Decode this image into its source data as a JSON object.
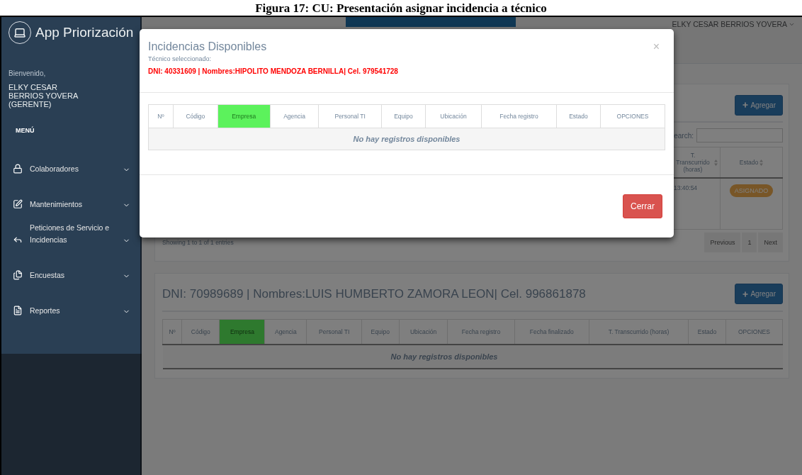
{
  "caption": "Figura 17: CU: Presentación asignar incidencia a técnico",
  "sidebar": {
    "title": "App Priorización",
    "welcome": "Bienvenido,",
    "user": "ELKY CESAR BERRIOS YOVERA (GERENTE)",
    "menu_label": "MENÚ",
    "items": [
      {
        "kind": "lock",
        "label": "Colaboradores"
      },
      {
        "kind": "edit",
        "label": "Mantenimientos"
      },
      {
        "kind": "reply",
        "label": "Peticiones de Servicio e Incidencias"
      },
      {
        "kind": "files",
        "label": "Encuestas"
      },
      {
        "kind": "report",
        "label": "Reportes"
      }
    ]
  },
  "topbar": {
    "user": "ELKY CESAR BERRIOS YOVERA"
  },
  "panel1": {
    "add_button": "Agregar",
    "search_label": "earch:",
    "columns": [
      {
        "label": "T. Transcurrido (horas)",
        "sortable": true
      },
      {
        "label": "Estado",
        "sortable": true
      }
    ],
    "rows": [
      {
        "time": "13:40:54",
        "status": "ASIGNADO"
      }
    ],
    "info": "Showing 1 to 1 of 1 entries",
    "pagination": [
      "Previous",
      "1",
      "Next"
    ]
  },
  "panel2": {
    "title": "DNI: 70989689 | Nombres:LUIS HUMBERTO ZAMORA LEON| Cel. 996861878",
    "add_button": "Agregar",
    "columns": [
      {
        "label": "Nº",
        "highlighted": false
      },
      {
        "label": "Código",
        "highlighted": false
      },
      {
        "label": "Empresa",
        "highlighted": true
      },
      {
        "label": "Agencia",
        "highlighted": false
      },
      {
        "label": "Personal TI",
        "highlighted": false
      },
      {
        "label": "Equipo",
        "highlighted": false
      },
      {
        "label": "Ubicación",
        "highlighted": false
      },
      {
        "label": "Fecha registro",
        "highlighted": false
      },
      {
        "label": "Fecha finalizado",
        "highlighted": false
      },
      {
        "label": "T. Transcurrido (horas)",
        "highlighted": false
      },
      {
        "label": "Estado",
        "highlighted": false
      },
      {
        "label": "OPCIONES",
        "highlighted": false
      }
    ],
    "empty": "No hay registros disponibles"
  },
  "modal": {
    "title": "Incidencias Disponibles",
    "subtitle": "Técnico seleccionado:",
    "technician": "DNI: 40331609 | Nombres:HIPOLITO MENDOZA BERNILLA| Cel. 979541728",
    "close_icon": "×",
    "columns": [
      {
        "label": "Nº",
        "highlighted": false
      },
      {
        "label": "Código",
        "highlighted": false
      },
      {
        "label": "Empresa",
        "highlighted": true
      },
      {
        "label": "Agencia",
        "highlighted": false
      },
      {
        "label": "Personal TI",
        "highlighted": false
      },
      {
        "label": "Equipo",
        "highlighted": false
      },
      {
        "label": "Ubicación",
        "highlighted": false
      },
      {
        "label": "Fecha registro",
        "highlighted": false
      },
      {
        "label": "Estado",
        "highlighted": false
      },
      {
        "label": "OPCIONES",
        "highlighted": false
      }
    ],
    "empty": "No hay registros disponibles",
    "close_button": "Cerrar"
  }
}
